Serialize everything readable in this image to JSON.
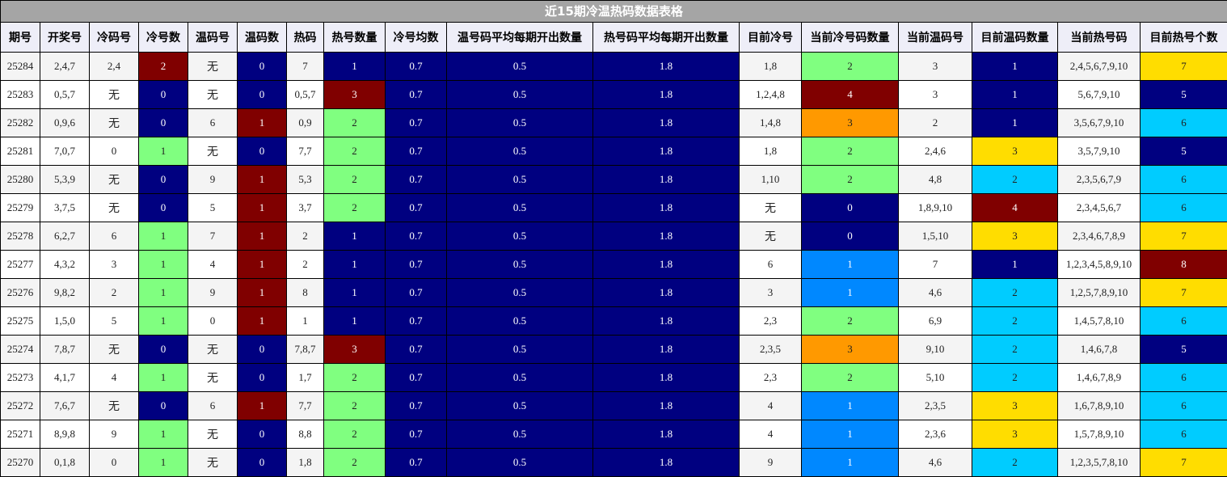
{
  "title": "近15期冷温热码数据表格",
  "columns": [
    "期号",
    "开奖号",
    "冷码号",
    "冷号数",
    "温码号",
    "温码数",
    "热码",
    "热号数量",
    "冷号均数",
    "温号码平均每期开出数量",
    "热号码平均每期开出数量",
    "目前冷号",
    "当前冷号码数量",
    "当前温码号",
    "目前温码数量",
    "当前热号码",
    "目前热号个数"
  ],
  "colors": {
    "dark_red": "#800000",
    "navy": "#000080",
    "green": "#80ff80",
    "orange": "#ff9900",
    "blue": "#0088ff",
    "yellow": "#ffdd00",
    "cyan": "#00ccff"
  },
  "rows": [
    {
      "issue": "25284",
      "draw": "2,4,7",
      "cold": "2,4",
      "cold_count": "2",
      "warm": "无",
      "warm_count": "0",
      "hot": "7",
      "hot_count": "1",
      "cold_avg": "0.7",
      "warm_avg": "0.5",
      "hot_avg": "1.8",
      "cur_cold": "1,8",
      "cur_cold_count": "2",
      "cur_warm": "3",
      "cur_warm_count": "1",
      "cur_hot": "2,4,5,6,7,9,10",
      "cur_hot_count": "7"
    },
    {
      "issue": "25283",
      "draw": "0,5,7",
      "cold": "无",
      "cold_count": "0",
      "warm": "无",
      "warm_count": "0",
      "hot": "0,5,7",
      "hot_count": "3",
      "cold_avg": "0.7",
      "warm_avg": "0.5",
      "hot_avg": "1.8",
      "cur_cold": "1,2,4,8",
      "cur_cold_count": "4",
      "cur_warm": "3",
      "cur_warm_count": "1",
      "cur_hot": "5,6,7,9,10",
      "cur_hot_count": "5"
    },
    {
      "issue": "25282",
      "draw": "0,9,6",
      "cold": "无",
      "cold_count": "0",
      "warm": "6",
      "warm_count": "1",
      "hot": "0,9",
      "hot_count": "2",
      "cold_avg": "0.7",
      "warm_avg": "0.5",
      "hot_avg": "1.8",
      "cur_cold": "1,4,8",
      "cur_cold_count": "3",
      "cur_warm": "2",
      "cur_warm_count": "1",
      "cur_hot": "3,5,6,7,9,10",
      "cur_hot_count": "6"
    },
    {
      "issue": "25281",
      "draw": "7,0,7",
      "cold": "0",
      "cold_count": "1",
      "warm": "无",
      "warm_count": "0",
      "hot": "7,7",
      "hot_count": "2",
      "cold_avg": "0.7",
      "warm_avg": "0.5",
      "hot_avg": "1.8",
      "cur_cold": "1,8",
      "cur_cold_count": "2",
      "cur_warm": "2,4,6",
      "cur_warm_count": "3",
      "cur_hot": "3,5,7,9,10",
      "cur_hot_count": "5"
    },
    {
      "issue": "25280",
      "draw": "5,3,9",
      "cold": "无",
      "cold_count": "0",
      "warm": "9",
      "warm_count": "1",
      "hot": "5,3",
      "hot_count": "2",
      "cold_avg": "0.7",
      "warm_avg": "0.5",
      "hot_avg": "1.8",
      "cur_cold": "1,10",
      "cur_cold_count": "2",
      "cur_warm": "4,8",
      "cur_warm_count": "2",
      "cur_hot": "2,3,5,6,7,9",
      "cur_hot_count": "6"
    },
    {
      "issue": "25279",
      "draw": "3,7,5",
      "cold": "无",
      "cold_count": "0",
      "warm": "5",
      "warm_count": "1",
      "hot": "3,7",
      "hot_count": "2",
      "cold_avg": "0.7",
      "warm_avg": "0.5",
      "hot_avg": "1.8",
      "cur_cold": "无",
      "cur_cold_count": "0",
      "cur_warm": "1,8,9,10",
      "cur_warm_count": "4",
      "cur_hot": "2,3,4,5,6,7",
      "cur_hot_count": "6"
    },
    {
      "issue": "25278",
      "draw": "6,2,7",
      "cold": "6",
      "cold_count": "1",
      "warm": "7",
      "warm_count": "1",
      "hot": "2",
      "hot_count": "1",
      "cold_avg": "0.7",
      "warm_avg": "0.5",
      "hot_avg": "1.8",
      "cur_cold": "无",
      "cur_cold_count": "0",
      "cur_warm": "1,5,10",
      "cur_warm_count": "3",
      "cur_hot": "2,3,4,6,7,8,9",
      "cur_hot_count": "7"
    },
    {
      "issue": "25277",
      "draw": "4,3,2",
      "cold": "3",
      "cold_count": "1",
      "warm": "4",
      "warm_count": "1",
      "hot": "2",
      "hot_count": "1",
      "cold_avg": "0.7",
      "warm_avg": "0.5",
      "hot_avg": "1.8",
      "cur_cold": "6",
      "cur_cold_count": "1",
      "cur_warm": "7",
      "cur_warm_count": "1",
      "cur_hot": "1,2,3,4,5,8,9,10",
      "cur_hot_count": "8"
    },
    {
      "issue": "25276",
      "draw": "9,8,2",
      "cold": "2",
      "cold_count": "1",
      "warm": "9",
      "warm_count": "1",
      "hot": "8",
      "hot_count": "1",
      "cold_avg": "0.7",
      "warm_avg": "0.5",
      "hot_avg": "1.8",
      "cur_cold": "3",
      "cur_cold_count": "1",
      "cur_warm": "4,6",
      "cur_warm_count": "2",
      "cur_hot": "1,2,5,7,8,9,10",
      "cur_hot_count": "7"
    },
    {
      "issue": "25275",
      "draw": "1,5,0",
      "cold": "5",
      "cold_count": "1",
      "warm": "0",
      "warm_count": "1",
      "hot": "1",
      "hot_count": "1",
      "cold_avg": "0.7",
      "warm_avg": "0.5",
      "hot_avg": "1.8",
      "cur_cold": "2,3",
      "cur_cold_count": "2",
      "cur_warm": "6,9",
      "cur_warm_count": "2",
      "cur_hot": "1,4,5,7,8,10",
      "cur_hot_count": "6"
    },
    {
      "issue": "25274",
      "draw": "7,8,7",
      "cold": "无",
      "cold_count": "0",
      "warm": "无",
      "warm_count": "0",
      "hot": "7,8,7",
      "hot_count": "3",
      "cold_avg": "0.7",
      "warm_avg": "0.5",
      "hot_avg": "1.8",
      "cur_cold": "2,3,5",
      "cur_cold_count": "3",
      "cur_warm": "9,10",
      "cur_warm_count": "2",
      "cur_hot": "1,4,6,7,8",
      "cur_hot_count": "5"
    },
    {
      "issue": "25273",
      "draw": "4,1,7",
      "cold": "4",
      "cold_count": "1",
      "warm": "无",
      "warm_count": "0",
      "hot": "1,7",
      "hot_count": "2",
      "cold_avg": "0.7",
      "warm_avg": "0.5",
      "hot_avg": "1.8",
      "cur_cold": "2,3",
      "cur_cold_count": "2",
      "cur_warm": "5,10",
      "cur_warm_count": "2",
      "cur_hot": "1,4,6,7,8,9",
      "cur_hot_count": "6"
    },
    {
      "issue": "25272",
      "draw": "7,6,7",
      "cold": "无",
      "cold_count": "0",
      "warm": "6",
      "warm_count": "1",
      "hot": "7,7",
      "hot_count": "2",
      "cold_avg": "0.7",
      "warm_avg": "0.5",
      "hot_avg": "1.8",
      "cur_cold": "4",
      "cur_cold_count": "1",
      "cur_warm": "2,3,5",
      "cur_warm_count": "3",
      "cur_hot": "1,6,7,8,9,10",
      "cur_hot_count": "6"
    },
    {
      "issue": "25271",
      "draw": "8,9,8",
      "cold": "9",
      "cold_count": "1",
      "warm": "无",
      "warm_count": "0",
      "hot": "8,8",
      "hot_count": "2",
      "cold_avg": "0.7",
      "warm_avg": "0.5",
      "hot_avg": "1.8",
      "cur_cold": "4",
      "cur_cold_count": "1",
      "cur_warm": "2,3,6",
      "cur_warm_count": "3",
      "cur_hot": "1,5,7,8,9,10",
      "cur_hot_count": "6"
    },
    {
      "issue": "25270",
      "draw": "0,1,8",
      "cold": "0",
      "cold_count": "1",
      "warm": "无",
      "warm_count": "0",
      "hot": "1,8",
      "hot_count": "2",
      "cold_avg": "0.7",
      "warm_avg": "0.5",
      "hot_avg": "1.8",
      "cur_cold": "9",
      "cur_cold_count": "1",
      "cur_warm": "4,6",
      "cur_warm_count": "2",
      "cur_hot": "1,2,3,5,7,8,10",
      "cur_hot_count": "7"
    }
  ]
}
